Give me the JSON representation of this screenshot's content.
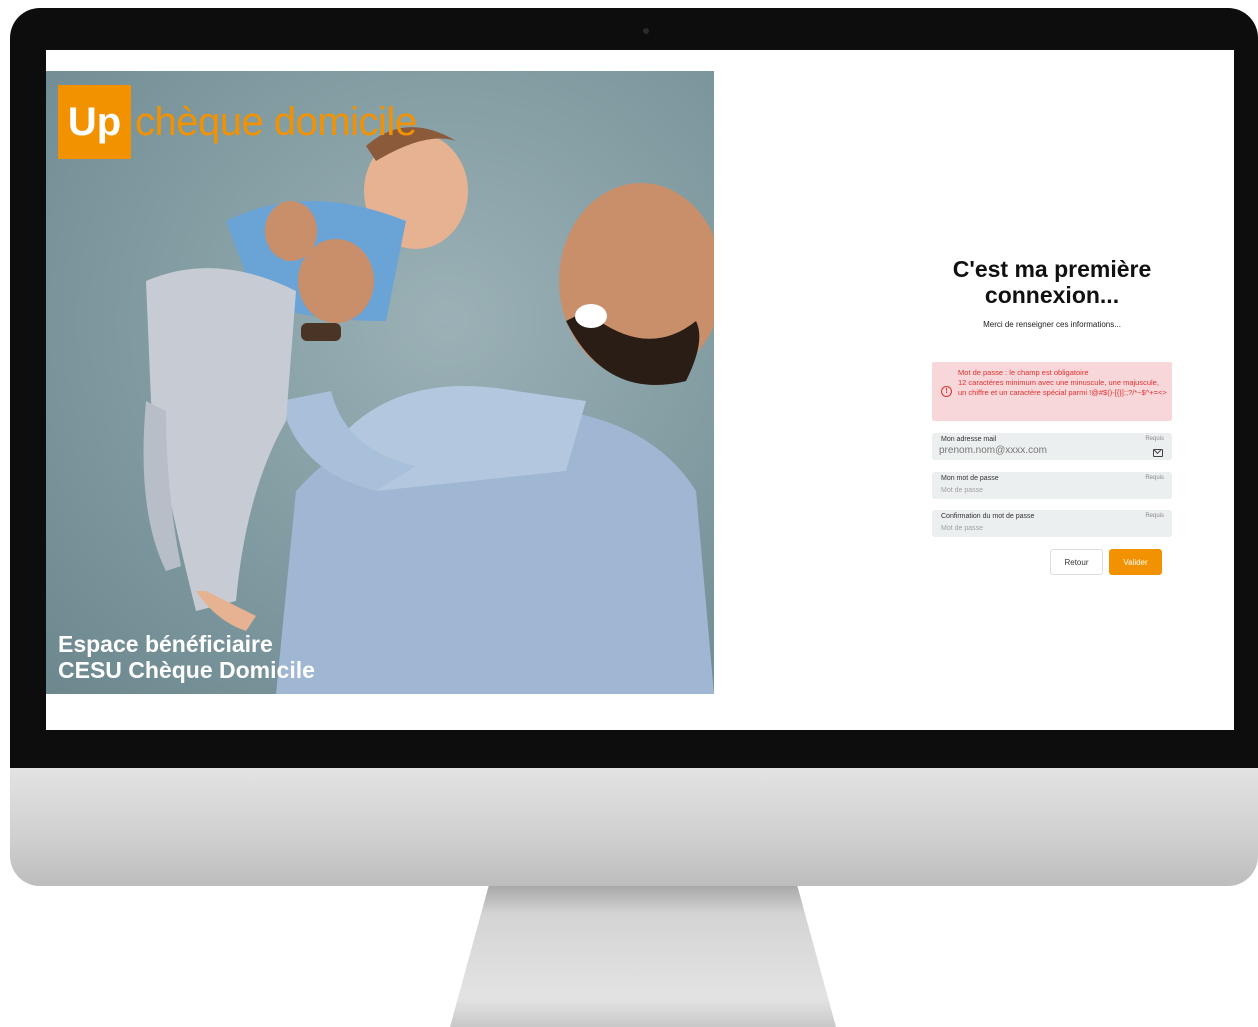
{
  "hero": {
    "logo_up": "Up",
    "logo_text": "chèque domicile",
    "caption_line1": "Espace bénéficiaire",
    "caption_line2": "CESU Chèque Domicile"
  },
  "form": {
    "title_line1": "C'est ma première",
    "title_line2": "connexion...",
    "subtitle": "Merci de renseigner ces informations...",
    "alert": {
      "line1": "Mot de passe : le champ est obligatoire",
      "line2": "12 caractères minimum avec une minuscule, une majuscule, un chiffre et un caractère spécial parmi !@#$()-[{}]:;?/*~$^+=<>"
    },
    "email": {
      "label": "Mon adresse mail",
      "required": "Requis",
      "placeholder": "prenom.nom@xxxx.com"
    },
    "password": {
      "label": "Mon mot de passe",
      "required": "Requis",
      "placeholder": "Mot de passe"
    },
    "confirm": {
      "label": "Confirmation du mot de passe",
      "required": "Requis",
      "placeholder": "Mot de passe"
    },
    "back_label": "Retour",
    "submit_label": "Valider"
  },
  "colors": {
    "brand_orange": "#f39200",
    "error_red": "#e0312d",
    "error_bg": "#f8d7db"
  },
  "icons": [
    "alert-circle-icon",
    "mail-icon"
  ]
}
